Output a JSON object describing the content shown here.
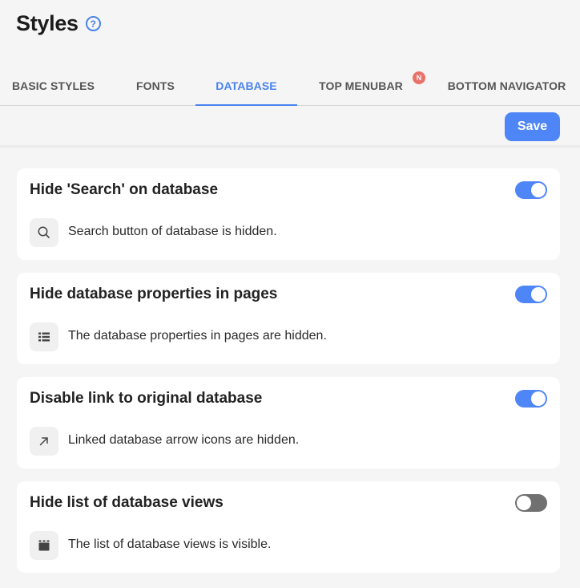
{
  "header": {
    "title": "Styles",
    "help_symbol": "?"
  },
  "tabs": [
    {
      "label": "BASIC STYLES",
      "active": false
    },
    {
      "label": "FONTS",
      "active": false
    },
    {
      "label": "DATABASE",
      "active": true
    },
    {
      "label": "TOP MENUBAR",
      "active": false,
      "badge": "N"
    },
    {
      "label": "BOTTOM NAVIGATOR",
      "active": false
    }
  ],
  "toolbar": {
    "save_label": "Save"
  },
  "colors": {
    "accent": "#4f86f7",
    "badge": "#e8716a",
    "toggle_off": "#707070"
  },
  "settings": [
    {
      "title": "Hide 'Search' on database",
      "description": "Search button of database is hidden.",
      "enabled": true,
      "icon": "search-icon"
    },
    {
      "title": "Hide database properties in pages",
      "description": "The database properties in pages are hidden.",
      "enabled": true,
      "icon": "list-icon"
    },
    {
      "title": "Disable link to original database",
      "description": "Linked database arrow icons are hidden.",
      "enabled": true,
      "icon": "arrow-up-right-icon"
    },
    {
      "title": "Hide list of database views",
      "description": "The list of database views is visible.",
      "enabled": false,
      "icon": "views-icon"
    }
  ]
}
